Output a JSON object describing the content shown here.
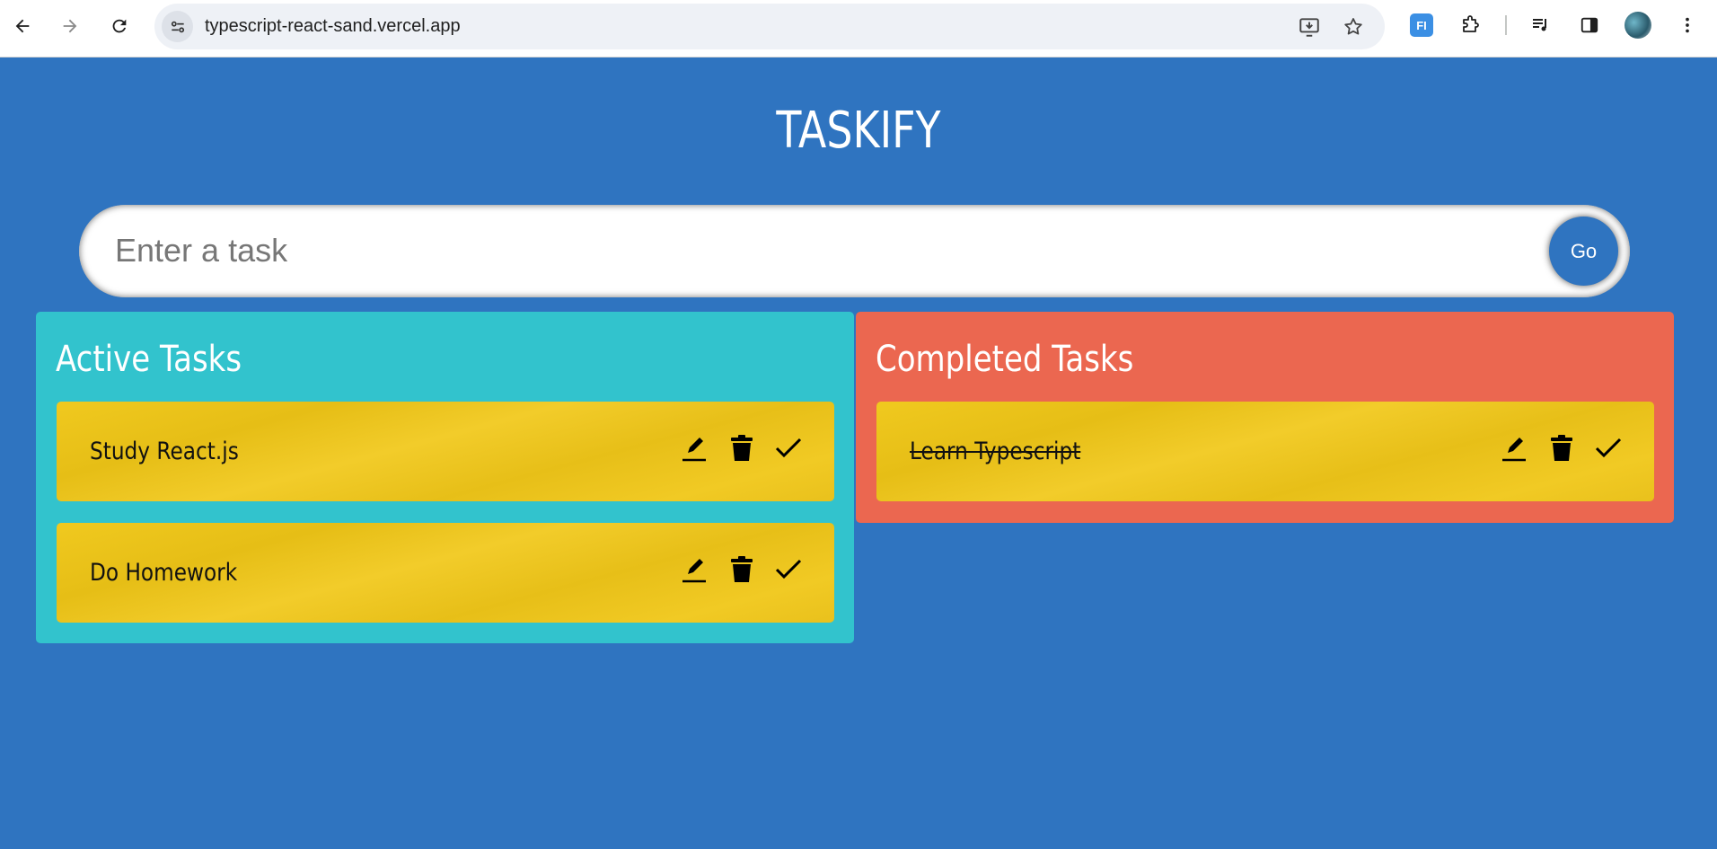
{
  "browser": {
    "url": "typescript-react-sand.vercel.app",
    "extension_badge": "FI"
  },
  "app": {
    "title": "TASKIFY",
    "input_placeholder": "Enter a task",
    "submit_label": "Go",
    "colors": {
      "background": "#2f74c0",
      "active_panel": "#32c3cd",
      "completed_panel": "#eb6750",
      "task_card": "#ecc41e"
    }
  },
  "active": {
    "heading": "Active Tasks",
    "tasks": [
      {
        "text": "Study React.js"
      },
      {
        "text": "Do Homework"
      }
    ]
  },
  "completed": {
    "heading": "Completed Tasks",
    "tasks": [
      {
        "text": "Learn Typescript"
      }
    ]
  },
  "icons": [
    "back-arrow-icon",
    "forward-arrow-icon",
    "reload-icon",
    "site-info-icon",
    "install-app-icon",
    "bookmark-star-icon",
    "extensions-icon",
    "media-controls-icon",
    "side-panel-icon",
    "more-menu-icon",
    "edit-icon",
    "delete-icon",
    "done-check-icon"
  ]
}
